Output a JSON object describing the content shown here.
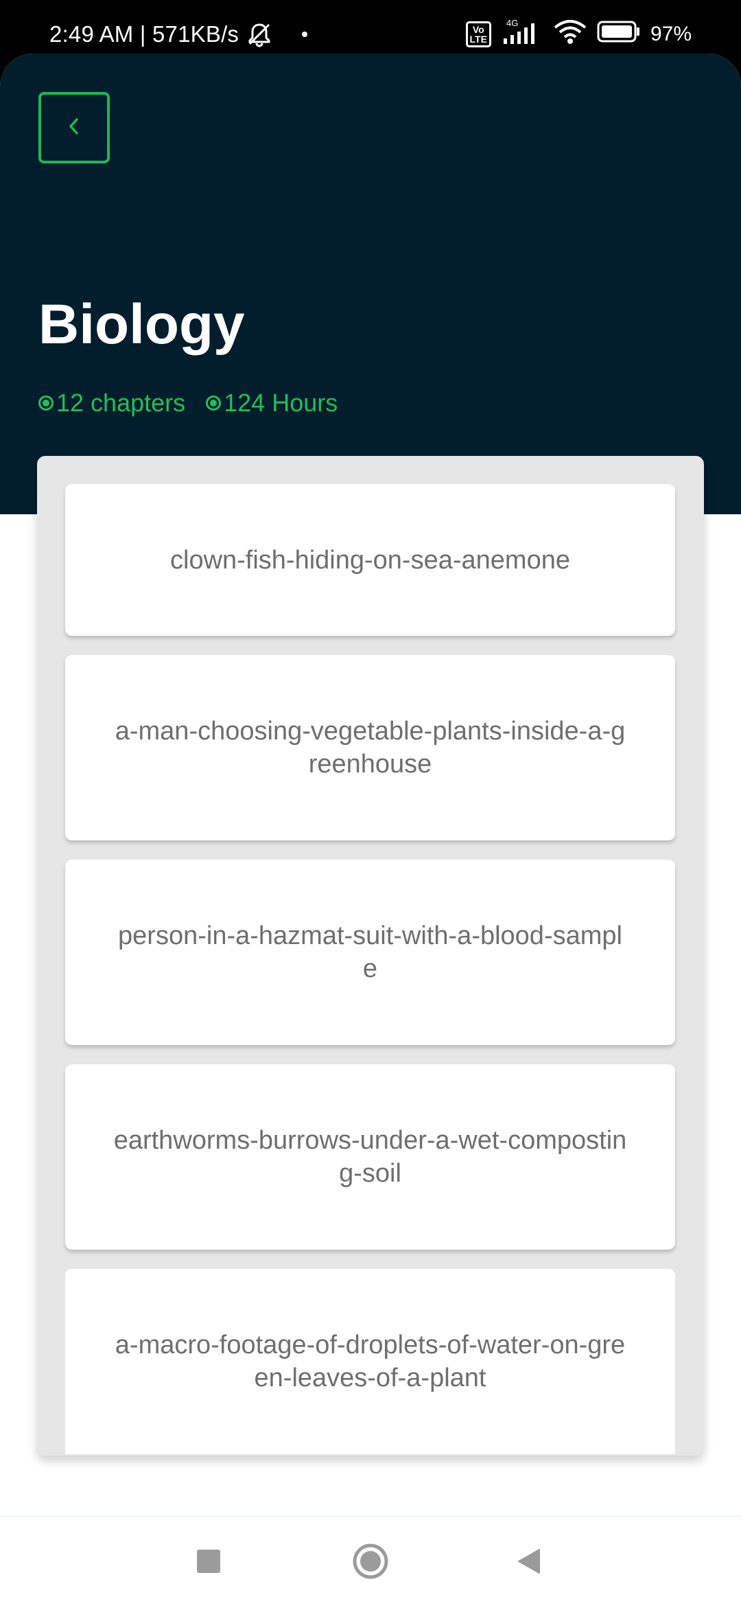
{
  "status_bar": {
    "time_speed": "2:49 AM | 571KB/s",
    "volte_label": "Vo\nLTE",
    "network_label": "4G",
    "battery": "97%",
    "icons": [
      "bell-muted-icon",
      "volte-icon",
      "signal-icon",
      "wifi-icon",
      "battery-icon"
    ]
  },
  "header": {
    "title": "Biology",
    "chapters": "12 chapters",
    "hours": "124 Hours",
    "accent_color": "#1fbf5b",
    "background_color": "#021d2c",
    "back_icon": "chevron-left-icon"
  },
  "list": {
    "items": [
      {
        "label": "clown-fish-hiding-on-sea-anemone"
      },
      {
        "label": "a-man-choosing-vegetable-plants-inside-a-greenhouse"
      },
      {
        "label": "person-in-a-hazmat-suit-with-a-blood-sample"
      },
      {
        "label": "earthworms-burrows-under-a-wet-composting-soil"
      },
      {
        "label": "a-macro-footage-of-droplets-of-water-on-green-leaves-of-a-plant"
      }
    ]
  },
  "nav_bar": {
    "icons": [
      "recents-square-icon",
      "home-circle-icon",
      "back-triangle-icon"
    ]
  }
}
